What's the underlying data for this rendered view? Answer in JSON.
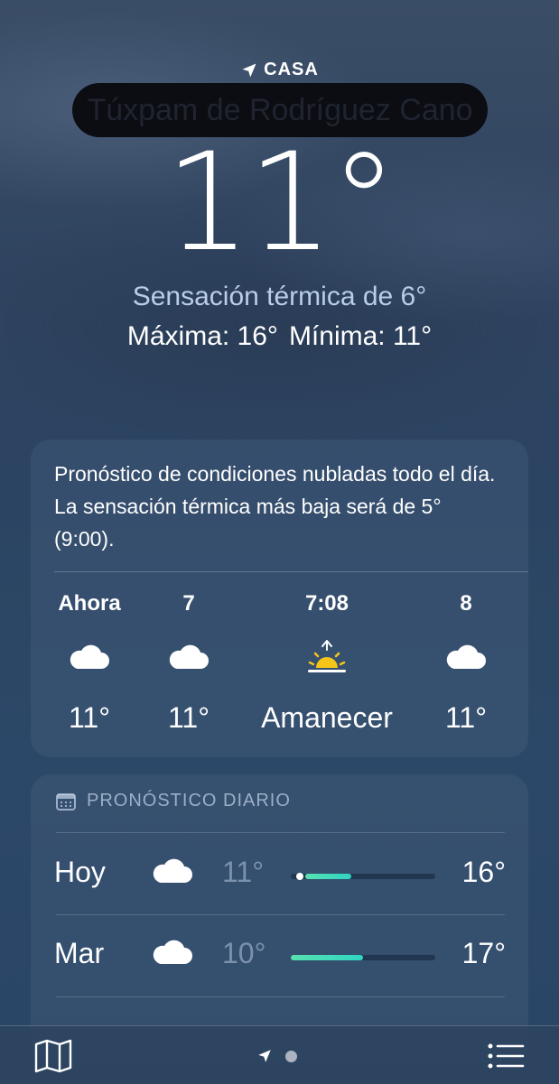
{
  "header": {
    "location_label": "CASA",
    "city": "Túxpam de Rodríguez Cano",
    "temperature": "11°",
    "feels_like": "Sensación térmica de 6°",
    "high": "Máxima: 16°",
    "low": "Mínima: 11°"
  },
  "hourly": {
    "summary": "Pronóstico de condiciones nubladas todo el día. La sensación térmica más baja será de 5° (9:00).",
    "items": [
      {
        "label": "Ahora",
        "icon": "cloud-icon",
        "value": "11°"
      },
      {
        "label": "7",
        "icon": "cloud-icon",
        "value": "11°"
      },
      {
        "label": "7:08",
        "icon": "sunrise-icon",
        "value": "Amanecer"
      },
      {
        "label": "8",
        "icon": "cloud-icon",
        "value": "11°"
      }
    ]
  },
  "daily": {
    "title": "PRONÓSTICO DIARIO",
    "days": [
      {
        "day": "Hoy",
        "icon": "cloud-icon",
        "low": "11°",
        "high": "16°",
        "bar_start": 0.1,
        "bar_end": 0.42,
        "current": 0.06
      },
      {
        "day": "Mar",
        "icon": "cloud-icon",
        "low": "10°",
        "high": "17°",
        "bar_start": 0.0,
        "bar_end": 0.5
      }
    ]
  },
  "colors": {
    "accent_bar": "#2fd4c2",
    "sunrise": "#f5c518",
    "feels_like_text": "#b9cdea"
  }
}
